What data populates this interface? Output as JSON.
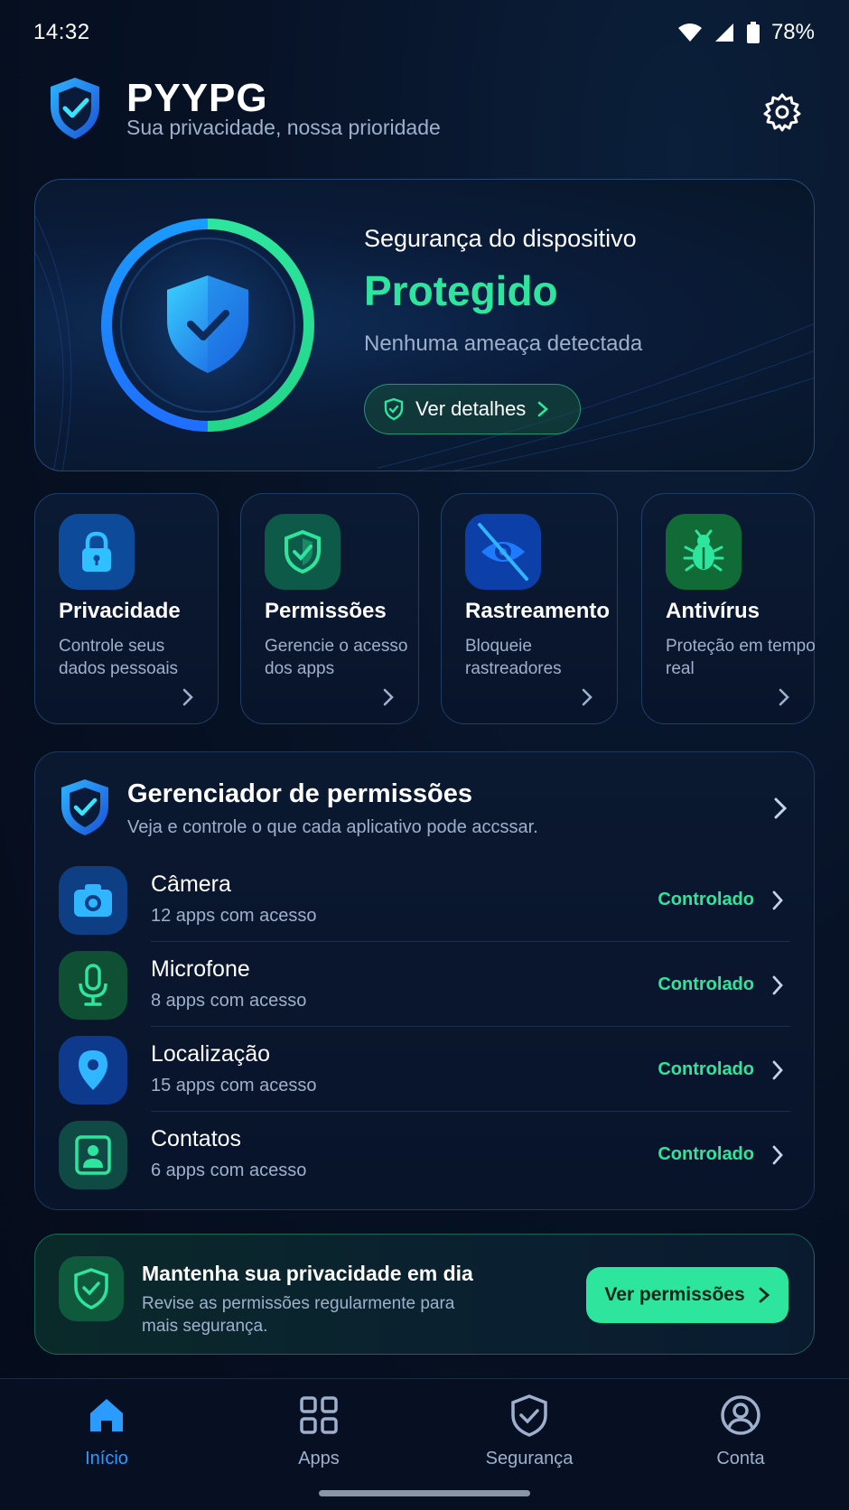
{
  "status_bar": {
    "time": "14:32",
    "battery": "78%"
  },
  "header": {
    "brand": "PYYPG",
    "subtitle": "Sua privacidade, nossa prioridade"
  },
  "hero": {
    "title": "Segurança do dispositivo",
    "status": "Protegido",
    "description": "Nenhuma ameaça detectada",
    "button_label": "Ver detalhes",
    "colors": {
      "accent_green": "#2ee59d",
      "accent_blue": "#2b9bff"
    }
  },
  "feature_cards": [
    {
      "title": "Privacidade",
      "description": "Controle seus dados pessoais",
      "icon": "lock-icon"
    },
    {
      "title": "Permissões",
      "description": "Gerencie o acesso dos apps",
      "icon": "shield-check-icon"
    },
    {
      "title": "Rastreamento",
      "description": "Bloqueie rastreadores",
      "icon": "eye-off-icon"
    },
    {
      "title": "Antivírus",
      "description": "Proteção em tempo real",
      "icon": "bug-icon"
    }
  ],
  "permission_manager": {
    "title": "Gerenciador de permissões",
    "subtitle": "Veja e controle o que cada aplicativo pode accssar.",
    "rows": [
      {
        "name": "Câmera",
        "count": "12 apps com acesso",
        "status": "Controlado",
        "icon": "camera-icon"
      },
      {
        "name": "Microfone",
        "count": "8 apps com acesso",
        "status": "Controlado",
        "icon": "microphone-icon"
      },
      {
        "name": "Localização",
        "count": "15 apps com acesso",
        "status": "Controlado",
        "icon": "location-pin-icon"
      },
      {
        "name": "Contatos",
        "count": "6 apps com acesso",
        "status": "Controlado",
        "icon": "contact-icon"
      }
    ]
  },
  "banner": {
    "title": "Mantenha sua privacidade em dia",
    "description": "Revise as permissões regularmente para mais segurança.",
    "button_label": "Ver permissões"
  },
  "bottom_nav": [
    {
      "label": "Início",
      "icon": "home-icon",
      "active": true
    },
    {
      "label": "Apps",
      "icon": "grid-icon",
      "active": false
    },
    {
      "label": "Segurança",
      "icon": "shield-icon",
      "active": false
    },
    {
      "label": "Conta",
      "icon": "user-circle-icon",
      "active": false
    }
  ]
}
